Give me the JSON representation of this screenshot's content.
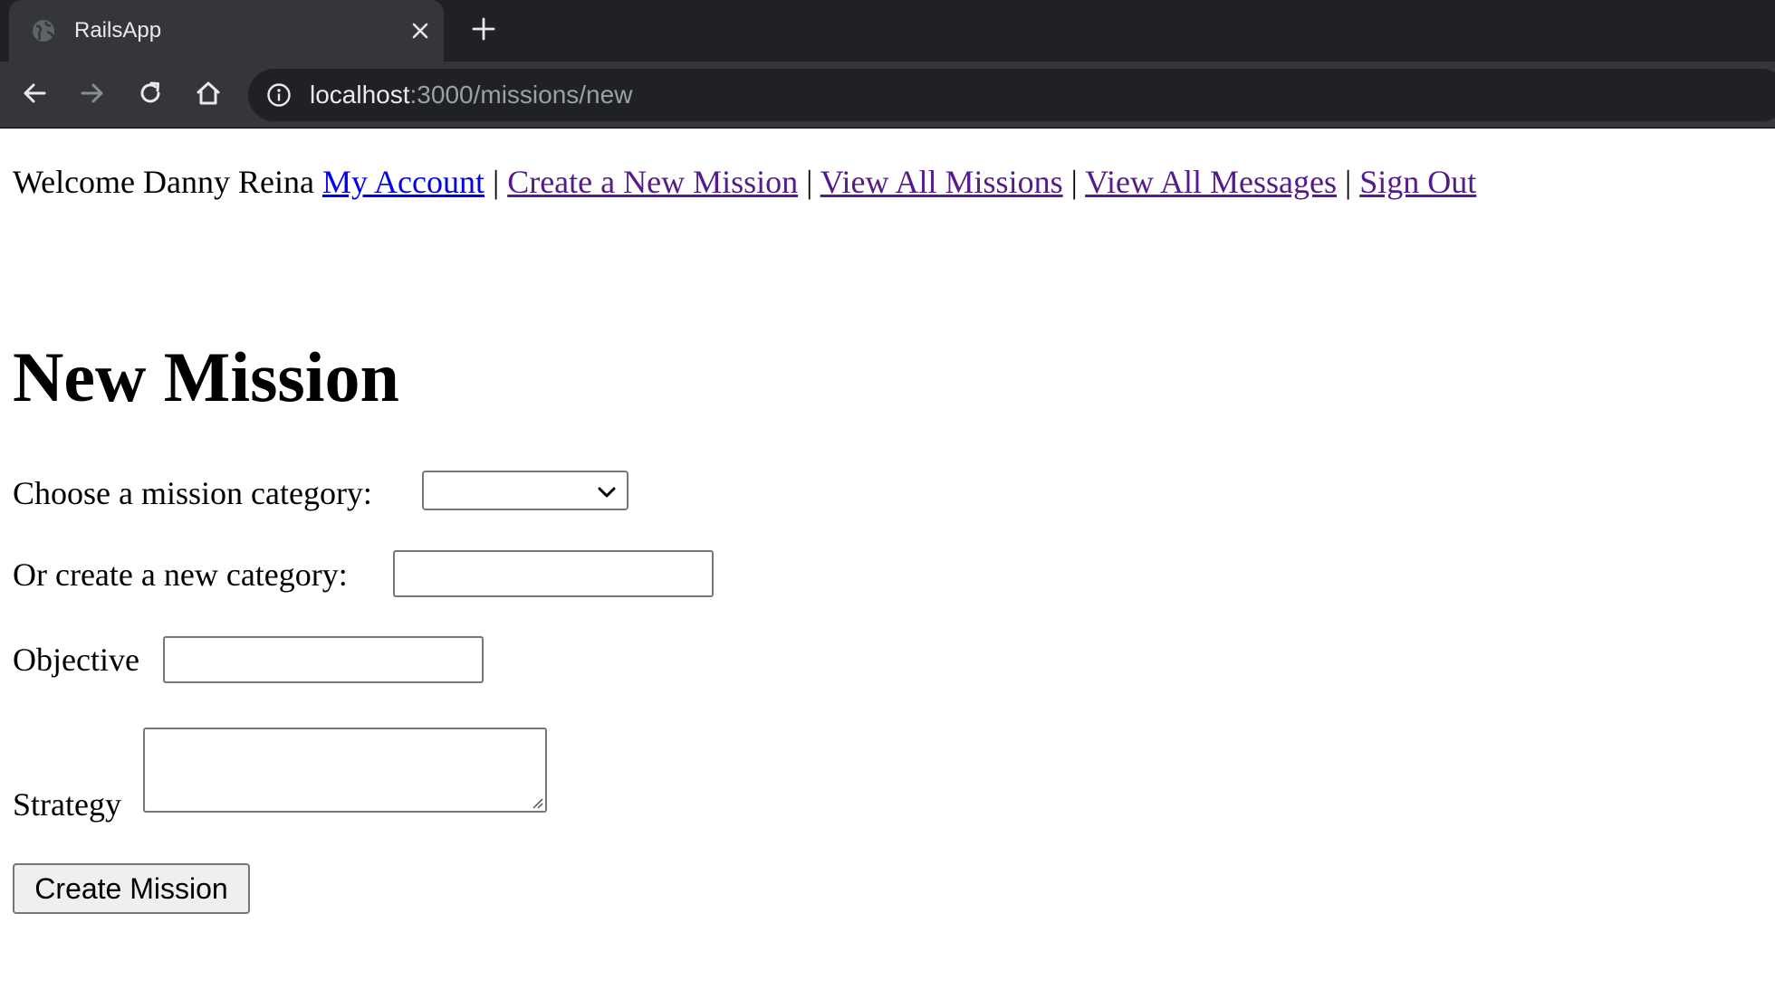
{
  "browser": {
    "tab_title": "RailsApp",
    "url_host": "localhost",
    "url_path": ":3000/missions/new",
    "icons": {
      "favicon": "globe-icon",
      "close": "close-icon",
      "new_tab": "plus-icon",
      "back": "back-arrow-icon",
      "forward": "forward-arrow-icon",
      "reload": "reload-icon",
      "home": "home-icon",
      "site_info": "info-icon"
    }
  },
  "nav": {
    "welcome": "Welcome Danny Reina",
    "links": [
      {
        "label": "My Account"
      },
      {
        "label": "Create a New Mission"
      },
      {
        "label": "View All Missions"
      },
      {
        "label": "View All Messages"
      },
      {
        "label": "Sign Out"
      }
    ],
    "separator": "|"
  },
  "form": {
    "title": "New Mission",
    "category_label": "Choose a mission category:",
    "category_selected": "",
    "new_category_label": "Or create a new category:",
    "new_category_value": "",
    "objective_label": "Objective",
    "objective_value": "",
    "strategy_label": "Strategy",
    "strategy_value": "",
    "submit_label": "Create Mission"
  },
  "colors": {
    "visited_link": "#551a8b",
    "unvisited_link": "#0000ee",
    "chrome_dark": "#202124",
    "chrome_toolbar": "#35363a"
  }
}
